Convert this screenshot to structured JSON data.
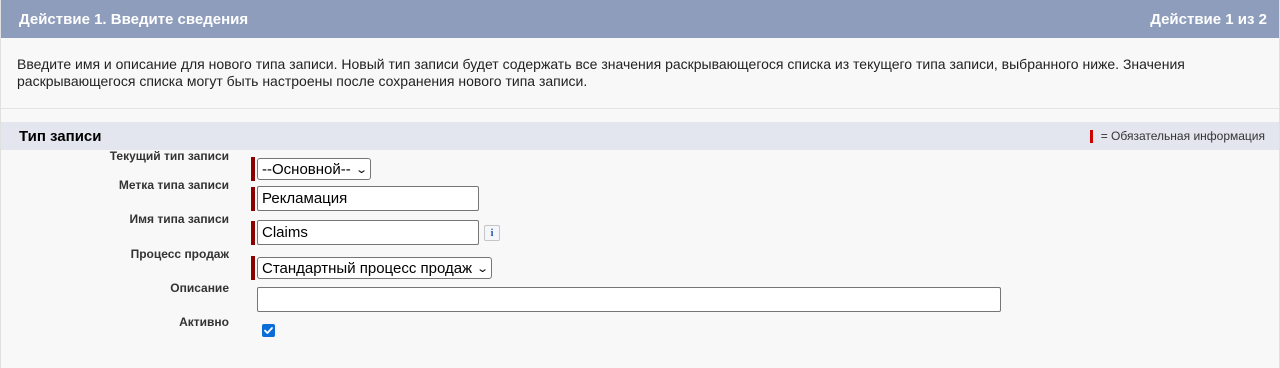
{
  "header": {
    "step_title": "Действие 1. Введите сведения",
    "step_counter": "Действие 1 из 2"
  },
  "intro_text": "Введите имя и описание для нового типа записи. Новый тип записи будет содержать все значения раскрывающегося списка из текущего типа записи, выбранного ниже. Значения раскрывающегося списка могут быть настроены после сохранения нового типа записи.",
  "section": {
    "title": "Тип записи",
    "required_legend": "= Обязательная информация"
  },
  "fields": {
    "current_type": {
      "label": "Текущий тип записи",
      "value": "--Основной--"
    },
    "type_label": {
      "label": "Метка типа записи",
      "value": "Рекламация"
    },
    "type_name": {
      "label": "Имя типа записи",
      "value": "Claims"
    },
    "sales_process": {
      "label": "Процесс продаж",
      "value": "Стандартный процесс продаж"
    },
    "description": {
      "label": "Описание",
      "value": ""
    },
    "active": {
      "label": "Активно",
      "checked": true
    }
  },
  "colors": {
    "header_bg": "#8e9dbb",
    "section_bg": "#e3e6ee",
    "required_bar": "#8b0000",
    "checkbox": "#0b6ed8"
  },
  "icons": {
    "info": "info-icon",
    "checkbox": "checkmark-icon",
    "dropdown": "chevron-down-icon"
  }
}
